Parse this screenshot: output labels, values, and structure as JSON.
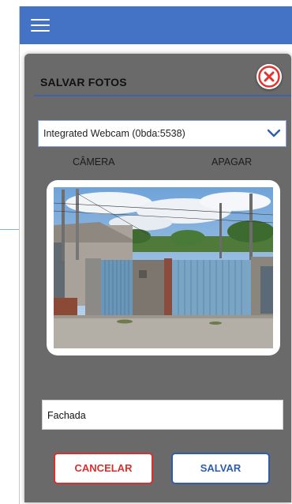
{
  "header": {
    "menu_icon": "hamburger-icon"
  },
  "dialog": {
    "title": "SALVAR FOTOS",
    "close_icon": "close-icon",
    "camera_select": {
      "value": "Integrated Webcam (0bda:5538)",
      "icon": "chevron-down-icon"
    },
    "camera_button": "CÂMERA",
    "delete_button": "APAGAR",
    "photo": {
      "subject": "captured photo of building facade with blue gates"
    },
    "description_input": {
      "value": "Fachada"
    },
    "cancel_button": "CANCELAR",
    "save_button": "SALVAR"
  },
  "colors": {
    "header": "#4472c4",
    "dialog_bg": "#6a6a6a",
    "accent_blue": "#2f5dae",
    "danger_red": "#d6312e"
  }
}
